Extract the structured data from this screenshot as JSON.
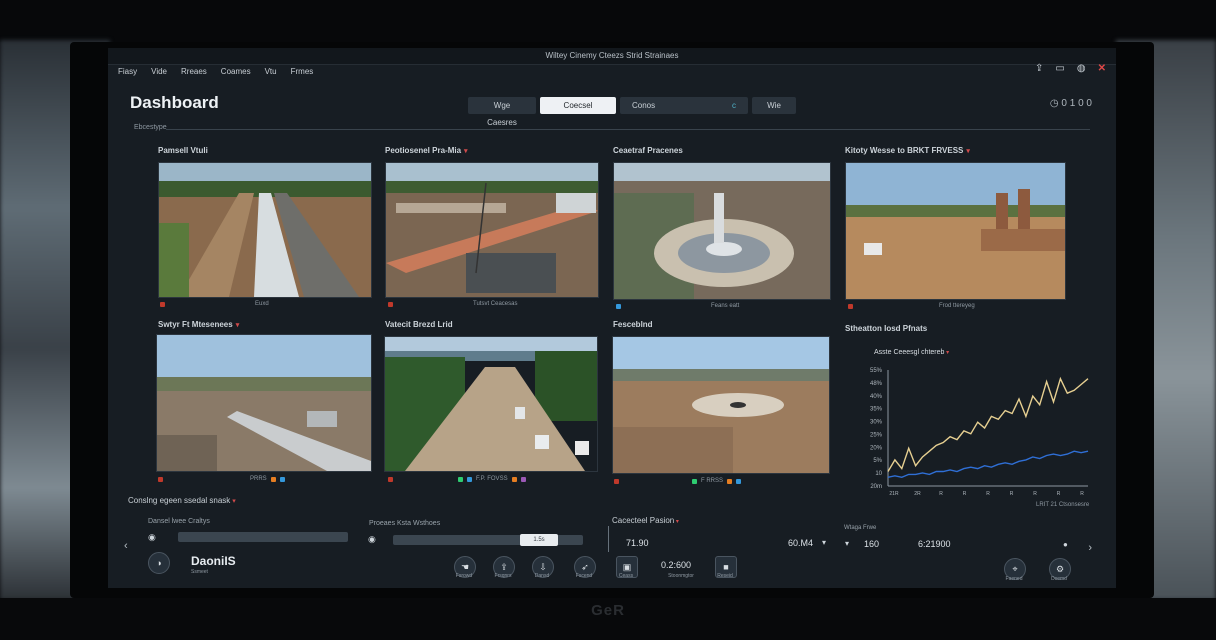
{
  "window": {
    "title": "Wiltey Cinemy Cteezs Strid Strainaes",
    "brand": "GeR"
  },
  "menu": [
    "Fiasy",
    "Vide",
    "Rreaes",
    "Coames",
    "Vtu",
    "Frmes"
  ],
  "header": {
    "title": "Dashboard",
    "section_label": "Ebcestype",
    "counter": "◷ 0 1 0 0"
  },
  "tabs": [
    "Wge Caesres",
    "Coecsel",
    "Conos",
    "c",
    "Wie"
  ],
  "cards": [
    {
      "title": "Pamsell Vtuli",
      "foot": "Euxd",
      "colors": [
        "#c0392b"
      ]
    },
    {
      "title": "Peotiosenel Pra-Mia",
      "foot": "Tutsvt Ceacesas",
      "colors": [
        "#c0392b"
      ]
    },
    {
      "title": "Ceaetraf Pracenes",
      "foot": "Feans eatt",
      "colors": [
        "#3498db"
      ]
    },
    {
      "title": "Kitoty Wesse to BRKT FRVESS",
      "foot": "Frod ttereyeg",
      "colors": [
        "#c0392b"
      ]
    },
    {
      "title": "Swtyr Ft Mtesenees",
      "foot": "PRRS",
      "colors": [
        "#c0392b",
        "#e67e22",
        "#3498db"
      ]
    },
    {
      "title": "Vatecit Brezd Lrid",
      "foot": "F.P. FOVSS",
      "colors": [
        "#c0392b",
        "#2ecc71",
        "#3498db",
        "#e67e22",
        "#9b59b6"
      ]
    },
    {
      "title": "Fesceblnd",
      "foot": "F RRSS",
      "colors": [
        "#c0392b",
        "#2ecc71",
        "#e67e22",
        "#3498db"
      ]
    }
  ],
  "chart": {
    "title": "Stheatton Iosd Pfnats",
    "subtitle": "Asste Ceeesgl chtereb",
    "y_ticks": [
      "55%",
      "48%",
      "40%",
      "35%",
      "30%",
      "25%",
      "20%",
      "5%",
      "10",
      "20m"
    ],
    "x_ticks": [
      "21R",
      "2R",
      "R",
      "R",
      "R",
      "R",
      "R",
      "R",
      "R"
    ],
    "footer": "LRIT 21 Ctsonsesre",
    "colors": {
      "primary": "#e6cf91",
      "secondary": "#2f6fd6"
    }
  },
  "chart_data": {
    "type": "line",
    "x": [
      1,
      2,
      3,
      4,
      5,
      6,
      7,
      8,
      9,
      10,
      11,
      12,
      13,
      14,
      15,
      16,
      17,
      18,
      19,
      20,
      21,
      22,
      23,
      24,
      25,
      26,
      27,
      28,
      29,
      30
    ],
    "series": [
      {
        "values": [
          10,
          18,
          12,
          26,
          14,
          20,
          24,
          28,
          30,
          34,
          32,
          38,
          36,
          44,
          40,
          48,
          46,
          52,
          50,
          60,
          48,
          62,
          56,
          72,
          58,
          74,
          64,
          66,
          70,
          74
        ]
      },
      {
        "values": [
          6,
          7,
          6,
          8,
          8,
          9,
          8,
          10,
          10,
          11,
          10,
          12,
          13,
          12,
          14,
          13,
          15,
          16,
          15,
          17,
          18,
          20,
          19,
          21,
          22,
          21,
          22,
          24,
          23,
          24
        ]
      }
    ],
    "ylim": [
      0,
      80
    ]
  },
  "lower": {
    "caption": "Conslng egeen ssedal snask",
    "slider1_label": "Dansel lwee Craltys",
    "slider2_label": "Proeaes Ksta Wsthoes",
    "slider2_value": "1.5s",
    "metrics_title": "Cacecteel Pasion",
    "metric1": "71.90",
    "metric2": "60.M4",
    "metric3_label": "Wtaga Frwe",
    "metric3": "160",
    "metric4": "6:21900"
  },
  "bottom": {
    "brand": "DaoniIS",
    "brand_sub": "Ssmeet",
    "buttons": [
      "Fsrowd",
      "Frsqnrs",
      "Dansd",
      "Fscend",
      "Ceass",
      "Stoonmgtor",
      "Reseid"
    ],
    "counter": "0.2:600",
    "right_buttons": [
      "Faened",
      "Dsemd"
    ]
  }
}
